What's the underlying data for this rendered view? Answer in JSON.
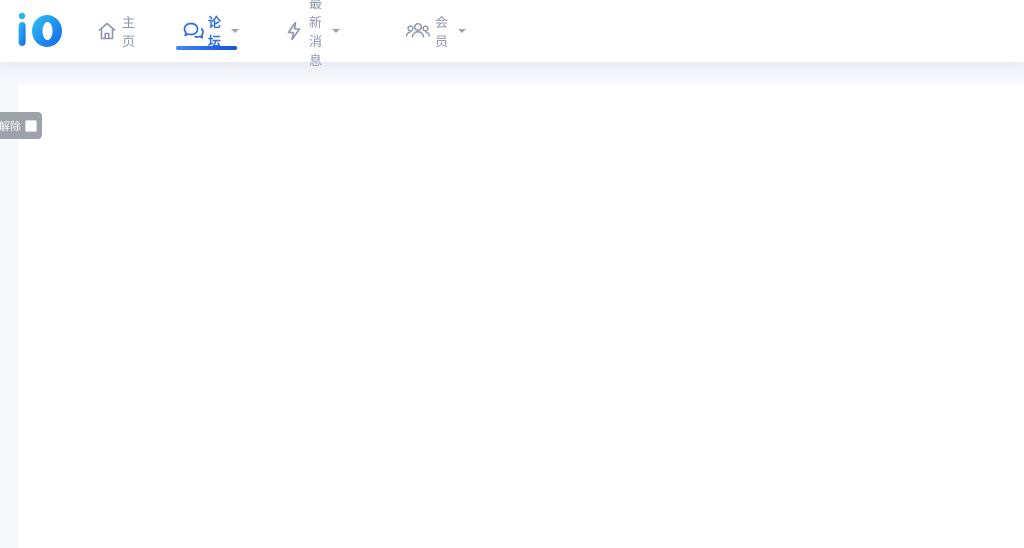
{
  "nav": {
    "items": [
      {
        "label": "主页",
        "icon": "home-icon"
      },
      {
        "label": "论坛",
        "icon": "chat-bubbles-icon",
        "active": true
      },
      {
        "label": "最新消息",
        "icon": "lightning-icon"
      },
      {
        "label": "会员",
        "icon": "users-icon"
      }
    ]
  },
  "lift_tab": {
    "label": "解除"
  },
  "colors": {
    "accent": "#2f6fe0",
    "nav_text": "#8d97ad",
    "page_bg": "#f7f8fc"
  }
}
